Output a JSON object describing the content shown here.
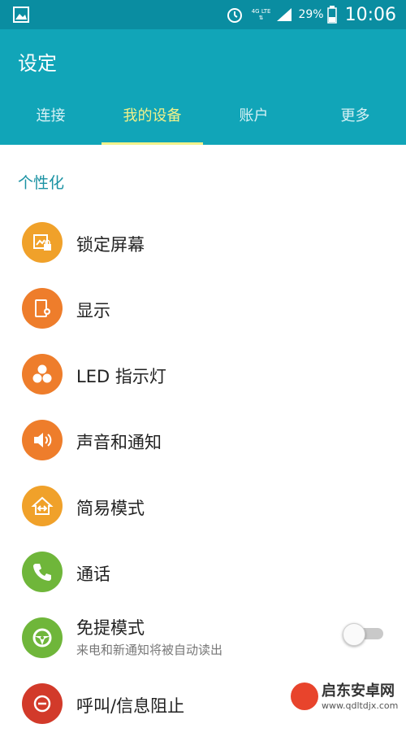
{
  "status_bar": {
    "network_label": "4G LTE",
    "battery": "29%",
    "time": "10:06",
    "icons": [
      "gallery-icon",
      "alarm-icon",
      "data-arrows-icon",
      "signal-icon",
      "battery-icon"
    ]
  },
  "header": {
    "title": "设定"
  },
  "tabs": [
    {
      "label": "连接",
      "active": false
    },
    {
      "label": "我的设备",
      "active": true
    },
    {
      "label": "账户",
      "active": false
    },
    {
      "label": "更多",
      "active": false
    }
  ],
  "section": {
    "label": "个性化"
  },
  "items": [
    {
      "label": "锁定屏幕",
      "icon": "lock-screen-icon",
      "color": "#f0a12a"
    },
    {
      "label": "显示",
      "icon": "display-icon",
      "color": "#ee7d2b"
    },
    {
      "label": "LED 指示灯",
      "icon": "led-indicator-icon",
      "color": "#ee7d2b"
    },
    {
      "label": "声音和通知",
      "icon": "sound-icon",
      "color": "#ee7d2b"
    },
    {
      "label": "简易模式",
      "icon": "easy-mode-icon",
      "color": "#f0a12a"
    },
    {
      "label": "通话",
      "icon": "phone-icon",
      "color": "#6fb63a"
    },
    {
      "label": "免提模式",
      "sublabel": "来电和新通知将被自动读出",
      "icon": "steering-wheel-icon",
      "color": "#6fb63a",
      "toggle_on": false
    },
    {
      "label": "呼叫/信息阻止",
      "icon": "block-icon",
      "color": "#d23a2a"
    }
  ],
  "watermark": {
    "brand": "启东安卓网",
    "url": "www.qdltdjx.com"
  },
  "colors": {
    "statusbar": "#0a8da1",
    "header": "#11a5b8",
    "accent": "#f2f28a",
    "section": "#1a92a3"
  }
}
